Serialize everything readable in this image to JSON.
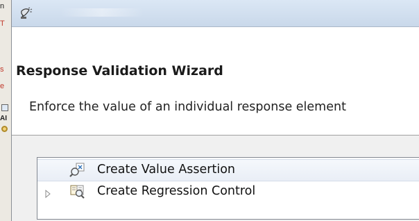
{
  "wizard": {
    "title": "Response Validation Wizard",
    "description": "Enforce the value of an individual response element"
  },
  "tree": {
    "items": [
      {
        "label": "Create Value Assertion",
        "icon": "magnifier-assertion-icon",
        "selected": true,
        "expandable": false
      },
      {
        "label": "Create Regression Control",
        "icon": "magnifier-book-icon",
        "selected": false,
        "expandable": true
      }
    ]
  },
  "background_fragments": [
    "n",
    "T",
    "s",
    "e",
    "I",
    "AI"
  ],
  "colors": {
    "titlebar": "#c9d8ea",
    "selection": "#e9eef6",
    "fragment_red": "#c0392b"
  }
}
